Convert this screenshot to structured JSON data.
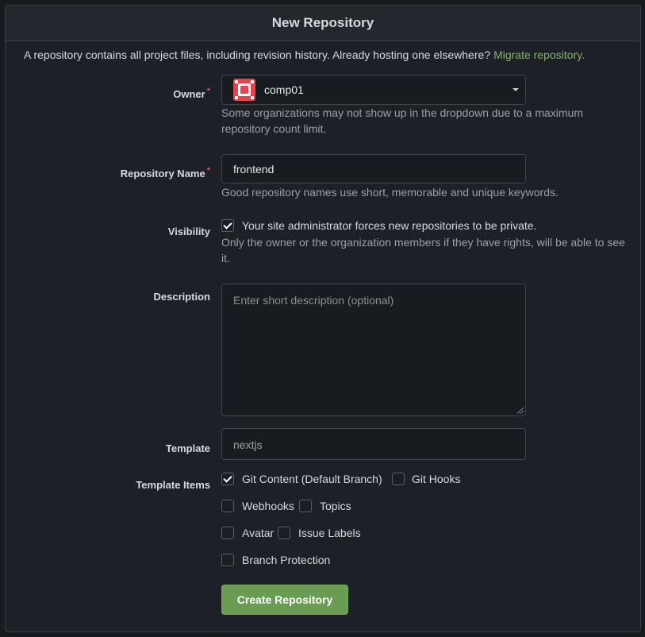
{
  "header": {
    "title": "New Repository"
  },
  "intro": {
    "text": "A repository contains all project files, including revision history. Already hosting one elsewhere?",
    "link_label": "Migrate repository."
  },
  "owner": {
    "label": "Owner",
    "required_mark": "*",
    "selected": "comp01",
    "help": "Some organizations may not show up in the dropdown due to a maximum repository count limit."
  },
  "repo_name": {
    "label": "Repository Name",
    "required_mark": "*",
    "value": "frontend",
    "help": "Good repository names use short, memorable and unique keywords."
  },
  "visibility": {
    "label": "Visibility",
    "checked": true,
    "checkbox_label": "Your site administrator forces new repositories to be private.",
    "help": "Only the owner or the organization members if they have rights, will be able to see it."
  },
  "description": {
    "label": "Description",
    "placeholder": "Enter short description (optional)"
  },
  "template": {
    "label": "Template",
    "value": "nextjs"
  },
  "template_items": {
    "label": "Template Items",
    "items": [
      {
        "label": "Git Content (Default Branch)",
        "checked": true
      },
      {
        "label": "Git Hooks",
        "checked": false
      },
      {
        "label": "Webhooks",
        "checked": false
      },
      {
        "label": "Topics",
        "checked": false
      },
      {
        "label": "Avatar",
        "checked": false
      },
      {
        "label": "Issue Labels",
        "checked": false
      },
      {
        "label": "Branch Protection",
        "checked": false
      }
    ]
  },
  "submit": {
    "label": "Create Repository"
  },
  "colors": {
    "accent_link": "#86b36b",
    "button": "#6a9c53",
    "required": "#e0534c",
    "avatar": "#e8424b"
  },
  "icons": {
    "owner_avatar": "org-avatar-icon",
    "dropdown": "caret-down-icon",
    "checkmark": "checkmark-icon"
  }
}
